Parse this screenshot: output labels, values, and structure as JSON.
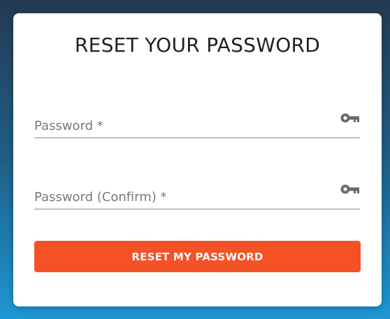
{
  "form": {
    "title": "RESET YOUR PASSWORD",
    "password": {
      "placeholder": "Password *",
      "value": "",
      "icon": "key-icon"
    },
    "password_confirm": {
      "placeholder": "Password (Confirm) *",
      "value": "",
      "icon": "key-icon"
    },
    "submit_label": "RESET MY PASSWORD"
  },
  "colors": {
    "accent": "#f55126",
    "card": "#ffffff",
    "background_top": "#243a52",
    "background_bottom": "#1e97d3"
  }
}
